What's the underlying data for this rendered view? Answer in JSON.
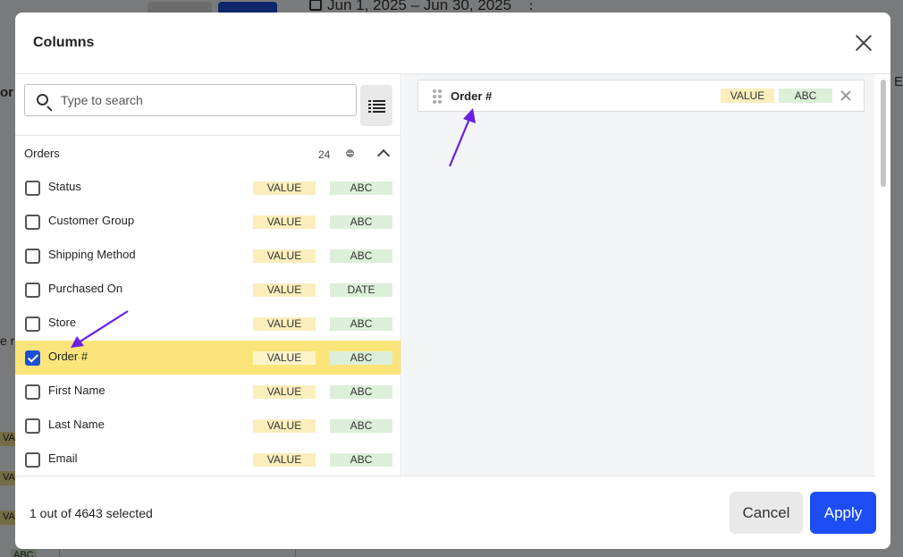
{
  "background": {
    "date_range": "Jun 1, 2025 – Jun 30, 2025",
    "fragment_or": "or",
    "fragment_re": "e re",
    "fragment_e": "E",
    "chip_va1": "VA",
    "chip_va2": "VA",
    "chip_va3": "VA",
    "chip_abc": "ABC"
  },
  "modal": {
    "title": "Columns",
    "search": {
      "placeholder": "Type to search",
      "value": ""
    },
    "group": {
      "name": "Orders",
      "count": "24"
    },
    "rows": [
      {
        "label": "Status",
        "value_tag": "VALUE",
        "type_tag": "ABC",
        "checked": false
      },
      {
        "label": "Customer Group",
        "value_tag": "VALUE",
        "type_tag": "ABC",
        "checked": false
      },
      {
        "label": "Shipping Method",
        "value_tag": "VALUE",
        "type_tag": "ABC",
        "checked": false
      },
      {
        "label": "Purchased On",
        "value_tag": "VALUE",
        "type_tag": "DATE",
        "checked": false
      },
      {
        "label": "Store",
        "value_tag": "VALUE",
        "type_tag": "ABC",
        "checked": false
      },
      {
        "label": "Order #",
        "value_tag": "VALUE",
        "type_tag": "ABC",
        "checked": true
      },
      {
        "label": "First Name",
        "value_tag": "VALUE",
        "type_tag": "ABC",
        "checked": false
      },
      {
        "label": "Last Name",
        "value_tag": "VALUE",
        "type_tag": "ABC",
        "checked": false
      },
      {
        "label": "Email",
        "value_tag": "VALUE",
        "type_tag": "ABC",
        "checked": false
      }
    ],
    "selected_columns": [
      {
        "label": "Order #",
        "value_tag": "VALUE",
        "type_tag": "ABC"
      }
    ],
    "footer": {
      "status": "1 out of 4643 selected",
      "cancel_label": "Cancel",
      "apply_label": "Apply"
    }
  },
  "colors": {
    "accent": "#1d4ef5",
    "selected_row": "#fbe57a",
    "value_tag": "#fbeebc",
    "type_tag": "#dcefd9",
    "annotation_arrow": "#6a1fe8"
  },
  "icons": [
    "calendar-icon",
    "kebab-icon",
    "close-icon",
    "search-icon",
    "list-view-icon",
    "status-dot-icon",
    "chevron-up-icon",
    "drag-handle-icon",
    "remove-icon",
    "checkbox-checked-icon"
  ]
}
